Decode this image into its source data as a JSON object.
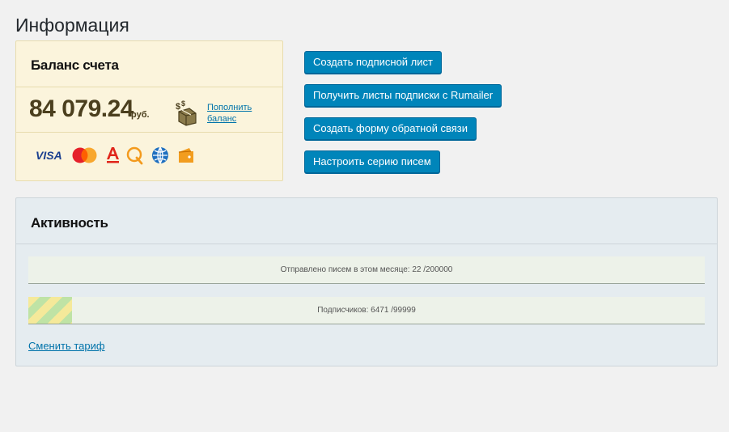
{
  "page": {
    "title": "Информация"
  },
  "balance": {
    "heading": "Баланс счета",
    "amount": "84 079.24",
    "currency": "руб.",
    "topup_label": "Пополнить баланс",
    "payment_methods": [
      "visa-icon",
      "mastercard-icon",
      "alfabank-icon",
      "qiwi-icon",
      "webmoney-icon",
      "yandex-money-icon"
    ]
  },
  "actions": [
    {
      "label": "Создать подписной лист"
    },
    {
      "label": "Получить листы подписки с Rumailer"
    },
    {
      "label": "Создать форму обратной связи"
    },
    {
      "label": "Настроить серию писем"
    }
  ],
  "activity": {
    "heading": "Активность",
    "emails_sent": {
      "text": "Отправлено писем в этом месяце: 22 /200000",
      "value": 22,
      "limit": 200000
    },
    "subscribers": {
      "text": "Подписчиков: 6471 /99999",
      "value": 6471,
      "limit": 99999
    },
    "change_plan_label": "Сменить тариф"
  },
  "colors": {
    "button": "#0085ba",
    "link": "#0073aa",
    "balance_bg": "#fbf4dc",
    "activity_bg": "#e5ecf0"
  }
}
